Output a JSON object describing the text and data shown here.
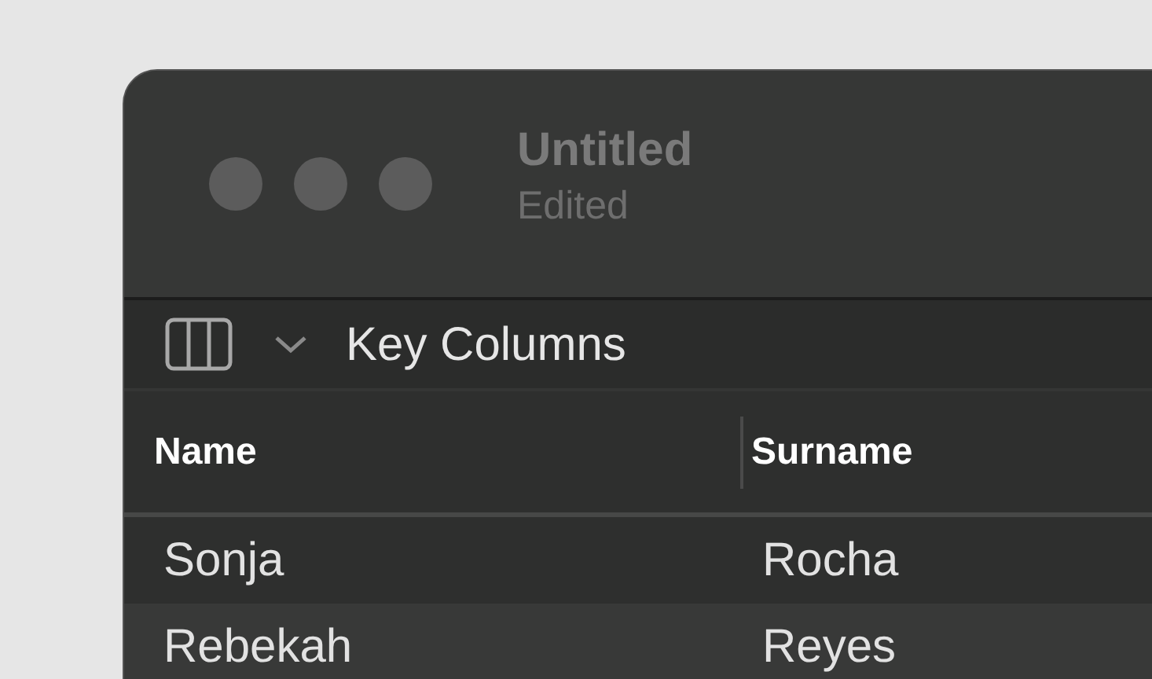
{
  "window": {
    "title": "Untitled",
    "subtitle": "Edited"
  },
  "toolbar": {
    "label": "Key Columns"
  },
  "table": {
    "columns": [
      "Name",
      "Surname"
    ],
    "rows": [
      {
        "cells": [
          "Sonja",
          "Rocha"
        ]
      },
      {
        "cells": [
          "Rebekah",
          "Reyes"
        ]
      }
    ]
  }
}
